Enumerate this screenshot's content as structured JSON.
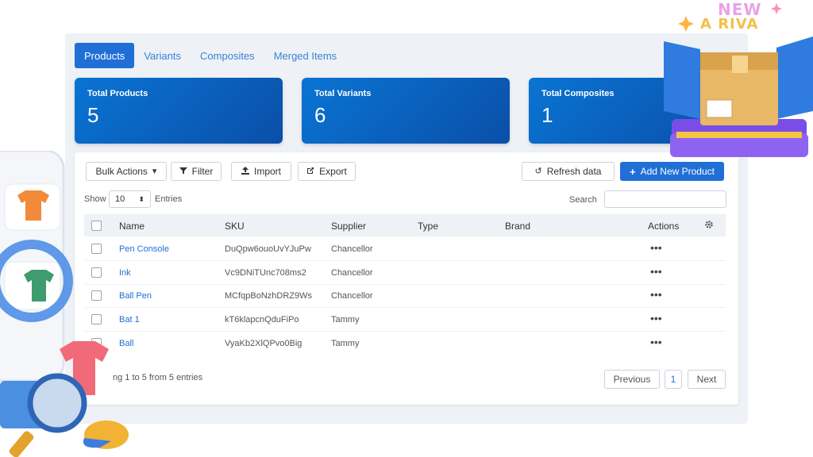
{
  "tabs": [
    "Products",
    "Variants",
    "Composites",
    "Merged Items"
  ],
  "cards": [
    {
      "label": "Total Products",
      "value": "5"
    },
    {
      "label": "Total Variants",
      "value": "6"
    },
    {
      "label": "Total Composites",
      "value": "1"
    }
  ],
  "toolbar": {
    "bulk_actions": "Bulk Actions",
    "filter": "Filter",
    "import": "Import",
    "export": "Export",
    "refresh": "Refresh data",
    "add_new": "Add New Product"
  },
  "entries": {
    "show_label": "Show",
    "value": "10",
    "entries_label": "Entries"
  },
  "search": {
    "label": "Search",
    "placeholder": ""
  },
  "table": {
    "columns": [
      "Name",
      "SKU",
      "Supplier",
      "Type",
      "Brand",
      "Actions"
    ],
    "rows": [
      {
        "name": "Pen Console",
        "sku": "DuQpw6ouoUvYJuPw",
        "supplier": "Chancellor",
        "type": "",
        "brand": "",
        "actions": "•••"
      },
      {
        "name": "Ink",
        "sku": "Vc9DNiTUnc708ms2",
        "supplier": "Chancellor",
        "type": "",
        "brand": "",
        "actions": "•••"
      },
      {
        "name": "Ball Pen",
        "sku": "MCfqpBoNzhDRZ9Ws",
        "supplier": "Chancellor",
        "type": "",
        "brand": "",
        "actions": "•••"
      },
      {
        "name": "Bat 1",
        "sku": "kT6klapcnQduFiPo",
        "supplier": "Tammy",
        "type": "",
        "brand": "",
        "actions": "•••"
      },
      {
        "name": "Ball",
        "sku": "VyaKb2XlQPvo0Big",
        "supplier": "Tammy",
        "type": "",
        "brand": "",
        "actions": "•••"
      }
    ]
  },
  "footer": {
    "showing": "ng 1 to 5 from 5 entries"
  },
  "pagination": {
    "previous": "Previous",
    "page": "1",
    "next": "Next"
  },
  "badge": {
    "line1": "NEW",
    "line2": "A RIVA"
  },
  "colors": {
    "primary": "#1f6fd6",
    "card_gradient_start": "#0a74d3",
    "card_gradient_end": "#0a4fa8",
    "panel_bg": "#eef1f6"
  }
}
